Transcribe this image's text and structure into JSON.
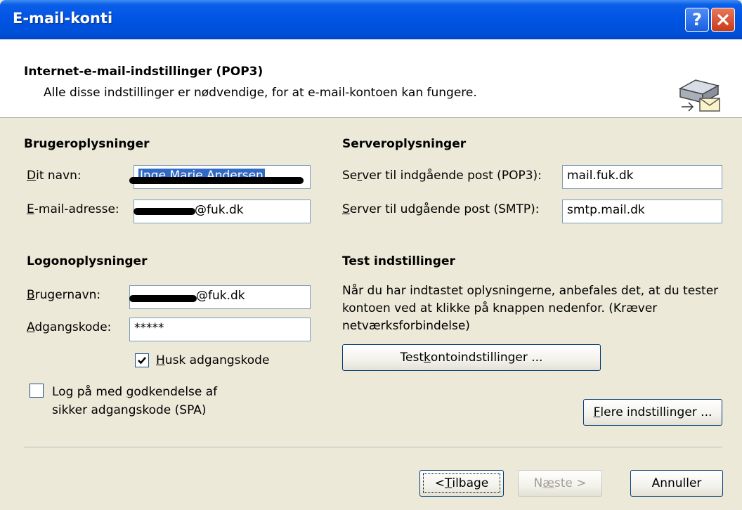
{
  "window": {
    "title": "E-mail-konti",
    "help_glyph": "?"
  },
  "header": {
    "title": "Internet-e-mail-indstillinger (POP3)",
    "subtitle": "Alle disse indstillinger er nødvendige, for at e-mail-kontoen kan fungere.",
    "icon": "mail-server-icon"
  },
  "user_info": {
    "heading": "Brugeroplysninger",
    "name_label_u": "D",
    "name_label_rest": "it navn:",
    "name_value": "Inge Marie Andersen",
    "email_label_u": "E",
    "email_label_rest": "-mail-adresse:",
    "email_value_suffix": "@fuk.dk"
  },
  "server_info": {
    "heading": "Serveroplysninger",
    "incoming_label_a": "Se",
    "incoming_label_u": "r",
    "incoming_label_b": "ver til indgående post (POP3):",
    "incoming_value": "mail.fuk.dk",
    "outgoing_label_u": "S",
    "outgoing_label_b": "erver til udgående post (SMTP):",
    "outgoing_value": "smtp.mail.dk"
  },
  "logon_info": {
    "heading": "Logonoplysninger",
    "username_label_u": "B",
    "username_label_rest": "rugernavn:",
    "username_value_suffix": "@fuk.dk",
    "password_label_u": "A",
    "password_label_rest": "dgangskode:",
    "password_value": "*****",
    "remember_label_u": "H",
    "remember_label_rest": "usk adgangskode",
    "remember_checked": true,
    "spa_label_line1_a": "Log på med ",
    "spa_label_line1_u": "g",
    "spa_label_line1_b": "odkendelse af",
    "spa_label_line2": "sikker adgangskode (SPA)",
    "spa_checked": false
  },
  "test_settings": {
    "heading": "Test indstillinger",
    "description": "Når du har indtastet oplysningerne, anbefales det, at du tester kontoen ved at klikke på knappen nedenfor. (Kræver netværksforbindelse)",
    "button_a": "Test ",
    "button_u": "k",
    "button_b": "ontoindstillinger ..."
  },
  "more_settings": {
    "button_u": "F",
    "button_rest": "lere indstillinger ..."
  },
  "footer": {
    "back_a": "< ",
    "back_u": "T",
    "back_b": "ilbage",
    "next_a": "N",
    "next_u": "æ",
    "next_b": "ste >",
    "cancel": "Annuller"
  },
  "colors": {
    "titlebar": "#0054e3",
    "dialog_bg": "#ece9d8",
    "selection": "#316ac5",
    "field_border": "#7f9db9"
  }
}
